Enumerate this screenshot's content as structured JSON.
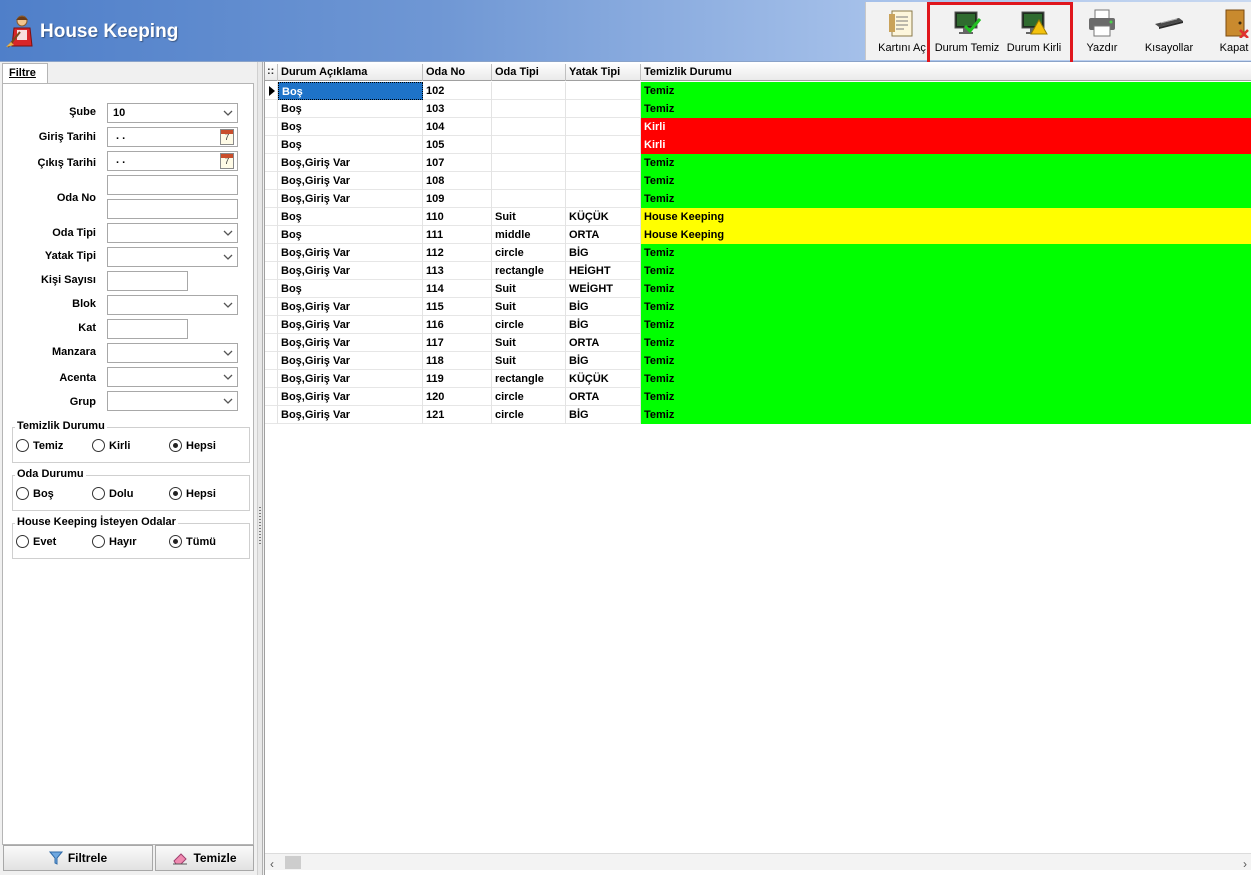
{
  "app": {
    "title": "House Keeping"
  },
  "toolbar": {
    "buttons": [
      {
        "label": "Kartını Aç",
        "icon": "card-open-icon"
      },
      {
        "label": "Durum Temiz",
        "icon": "status-clean-icon"
      },
      {
        "label": "Durum Kirli",
        "icon": "status-dirty-icon"
      },
      {
        "label": "Yazdır",
        "icon": "printer-icon"
      },
      {
        "label": "Kısayollar",
        "icon": "shortcuts-icon"
      },
      {
        "label": "Kapat",
        "icon": "close-door-icon"
      }
    ],
    "highlight_color": "#e0161d"
  },
  "filter": {
    "tab": "Filtre",
    "fields": {
      "sube": {
        "label": "Şube",
        "value": "10"
      },
      "giris_tarihi": {
        "label": "Giriş Tarihi",
        "value": ". ."
      },
      "cikis_tarihi": {
        "label": "Çıkış Tarihi",
        "value": ". ."
      },
      "oda_no": {
        "label": "Oda No",
        "value": ""
      },
      "oda_tipi": {
        "label": "Oda Tipi",
        "value": ""
      },
      "yatak_tipi": {
        "label": "Yatak Tipi",
        "value": ""
      },
      "kisi_sayisi": {
        "label": "Kişi Sayısı",
        "value": ""
      },
      "blok": {
        "label": "Blok",
        "value": ""
      },
      "kat": {
        "label": "Kat",
        "value": ""
      },
      "manzara": {
        "label": "Manzara",
        "value": ""
      },
      "acenta": {
        "label": "Acenta",
        "value": ""
      },
      "grup": {
        "label": "Grup",
        "value": ""
      }
    },
    "groups": {
      "temizlik": {
        "title": "Temizlik Durumu",
        "options": [
          "Temiz",
          "Kirli",
          "Hepsi"
        ],
        "selected": "Hepsi"
      },
      "oda": {
        "title": "Oda Durumu",
        "options": [
          "Boş",
          "Dolu",
          "Hepsi"
        ],
        "selected": "Hepsi"
      },
      "housekeeping": {
        "title": "House Keeping İsteyen Odalar",
        "options": [
          "Evet",
          "Hayır",
          "Tümü"
        ],
        "selected": "Tümü"
      }
    },
    "buttons": {
      "filter": "Filtrele",
      "clear": "Temizle"
    }
  },
  "grid": {
    "columns": [
      "Durum Açıklama",
      "Oda No",
      "Oda Tipi",
      "Yatak Tipi",
      "Temizlik Durumu"
    ],
    "status_colors": {
      "Temiz": "#00ff00",
      "Kirli": "#ff0000",
      "House Keeping": "#ffff00"
    },
    "rows": [
      {
        "durum": "Boş",
        "oda_no": "102",
        "oda_tipi": "",
        "yatak_tipi": "",
        "temizlik": "Temiz",
        "selected": true
      },
      {
        "durum": "Boş",
        "oda_no": "103",
        "oda_tipi": "",
        "yatak_tipi": "",
        "temizlik": "Temiz"
      },
      {
        "durum": "Boş",
        "oda_no": "104",
        "oda_tipi": "",
        "yatak_tipi": "",
        "temizlik": "Kirli"
      },
      {
        "durum": "Boş",
        "oda_no": "105",
        "oda_tipi": "",
        "yatak_tipi": "",
        "temizlik": "Kirli"
      },
      {
        "durum": "Boş,Giriş Var",
        "oda_no": "107",
        "oda_tipi": "",
        "yatak_tipi": "",
        "temizlik": "Temiz"
      },
      {
        "durum": "Boş,Giriş Var",
        "oda_no": "108",
        "oda_tipi": "",
        "yatak_tipi": "",
        "temizlik": "Temiz"
      },
      {
        "durum": "Boş,Giriş Var",
        "oda_no": "109",
        "oda_tipi": "",
        "yatak_tipi": "",
        "temizlik": "Temiz"
      },
      {
        "durum": "Boş",
        "oda_no": "110",
        "oda_tipi": "Suit",
        "yatak_tipi": "KÜÇÜK",
        "temizlik": "House Keeping"
      },
      {
        "durum": "Boş",
        "oda_no": "111",
        "oda_tipi": "middle",
        "yatak_tipi": "ORTA",
        "temizlik": "House Keeping"
      },
      {
        "durum": "Boş,Giriş Var",
        "oda_no": "112",
        "oda_tipi": "circle",
        "yatak_tipi": "BİG",
        "temizlik": "Temiz"
      },
      {
        "durum": "Boş,Giriş Var",
        "oda_no": "113",
        "oda_tipi": "rectangle",
        "yatak_tipi": "HEİGHT",
        "temizlik": "Temiz"
      },
      {
        "durum": "Boş",
        "oda_no": "114",
        "oda_tipi": "Suit",
        "yatak_tipi": "WEİGHT",
        "temizlik": "Temiz"
      },
      {
        "durum": "Boş,Giriş Var",
        "oda_no": "115",
        "oda_tipi": "Suit",
        "yatak_tipi": "BİG",
        "temizlik": "Temiz"
      },
      {
        "durum": "Boş,Giriş Var",
        "oda_no": "116",
        "oda_tipi": "circle",
        "yatak_tipi": "BİG",
        "temizlik": "Temiz"
      },
      {
        "durum": "Boş,Giriş Var",
        "oda_no": "117",
        "oda_tipi": "Suit",
        "yatak_tipi": "ORTA",
        "temizlik": "Temiz"
      },
      {
        "durum": "Boş,Giriş Var",
        "oda_no": "118",
        "oda_tipi": "Suit",
        "yatak_tipi": "BİG",
        "temizlik": "Temiz"
      },
      {
        "durum": "Boş,Giriş Var",
        "oda_no": "119",
        "oda_tipi": "rectangle",
        "yatak_tipi": "KÜÇÜK",
        "temizlik": "Temiz"
      },
      {
        "durum": "Boş,Giriş Var",
        "oda_no": "120",
        "oda_tipi": "circle",
        "yatak_tipi": "ORTA",
        "temizlik": "Temiz"
      },
      {
        "durum": "Boş,Giriş Var",
        "oda_no": "121",
        "oda_tipi": "circle",
        "yatak_tipi": "BİG",
        "temizlik": "Temiz"
      }
    ]
  }
}
